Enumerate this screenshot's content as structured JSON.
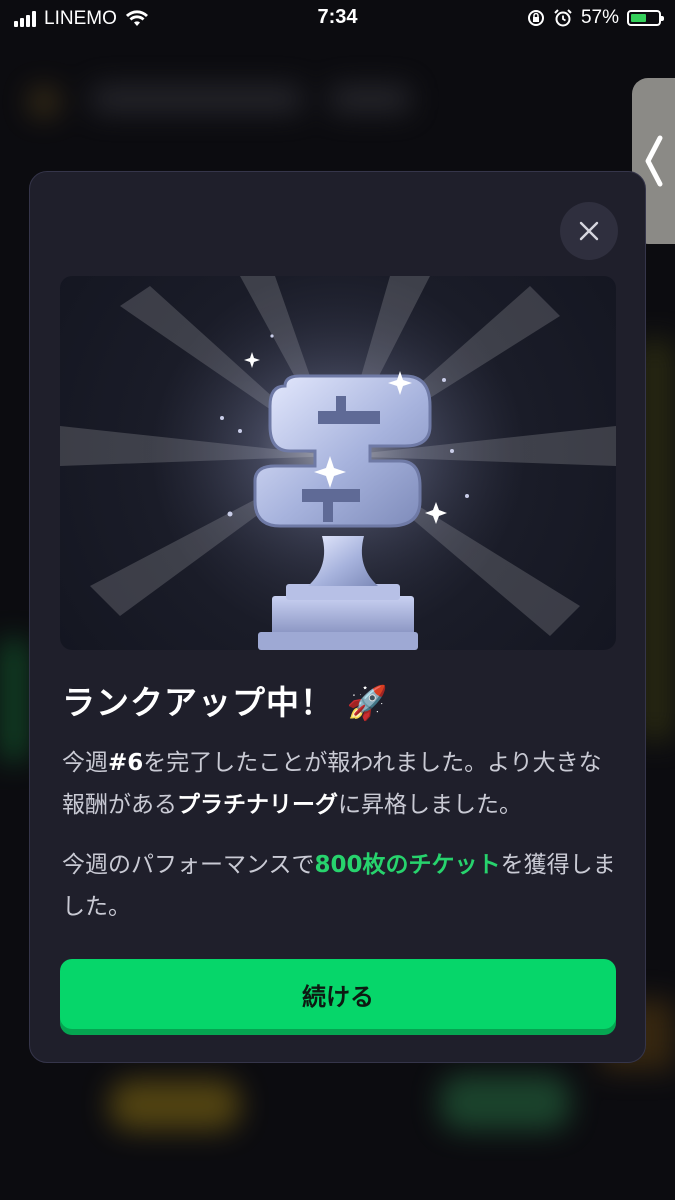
{
  "status_bar": {
    "carrier": "LINEMO",
    "time": "7:34",
    "battery_percent": "57%",
    "battery_level": 0.57
  },
  "modal": {
    "title": "ランクアップ中！",
    "title_emoji": "🚀",
    "paragraph1": {
      "prefix": "今週",
      "rank": "#6",
      "middle": "を完了したことが報われました。より大きな報酬がある",
      "league": "プラチナリーグ",
      "suffix": "に昇格しました。"
    },
    "paragraph2": {
      "prefix": "今週のパフォーマンスで",
      "reward": "800枚のチケット",
      "suffix": "を獲得しました。"
    },
    "continue_label": "続ける"
  },
  "icons": {
    "close": "close-icon",
    "trophy": "trophy-icon",
    "side_handle": "chevron-left-icon"
  },
  "colors": {
    "accent_green": "#06d66a",
    "highlight_green": "#27d36d",
    "modal_bg": "#1f1f2b"
  }
}
